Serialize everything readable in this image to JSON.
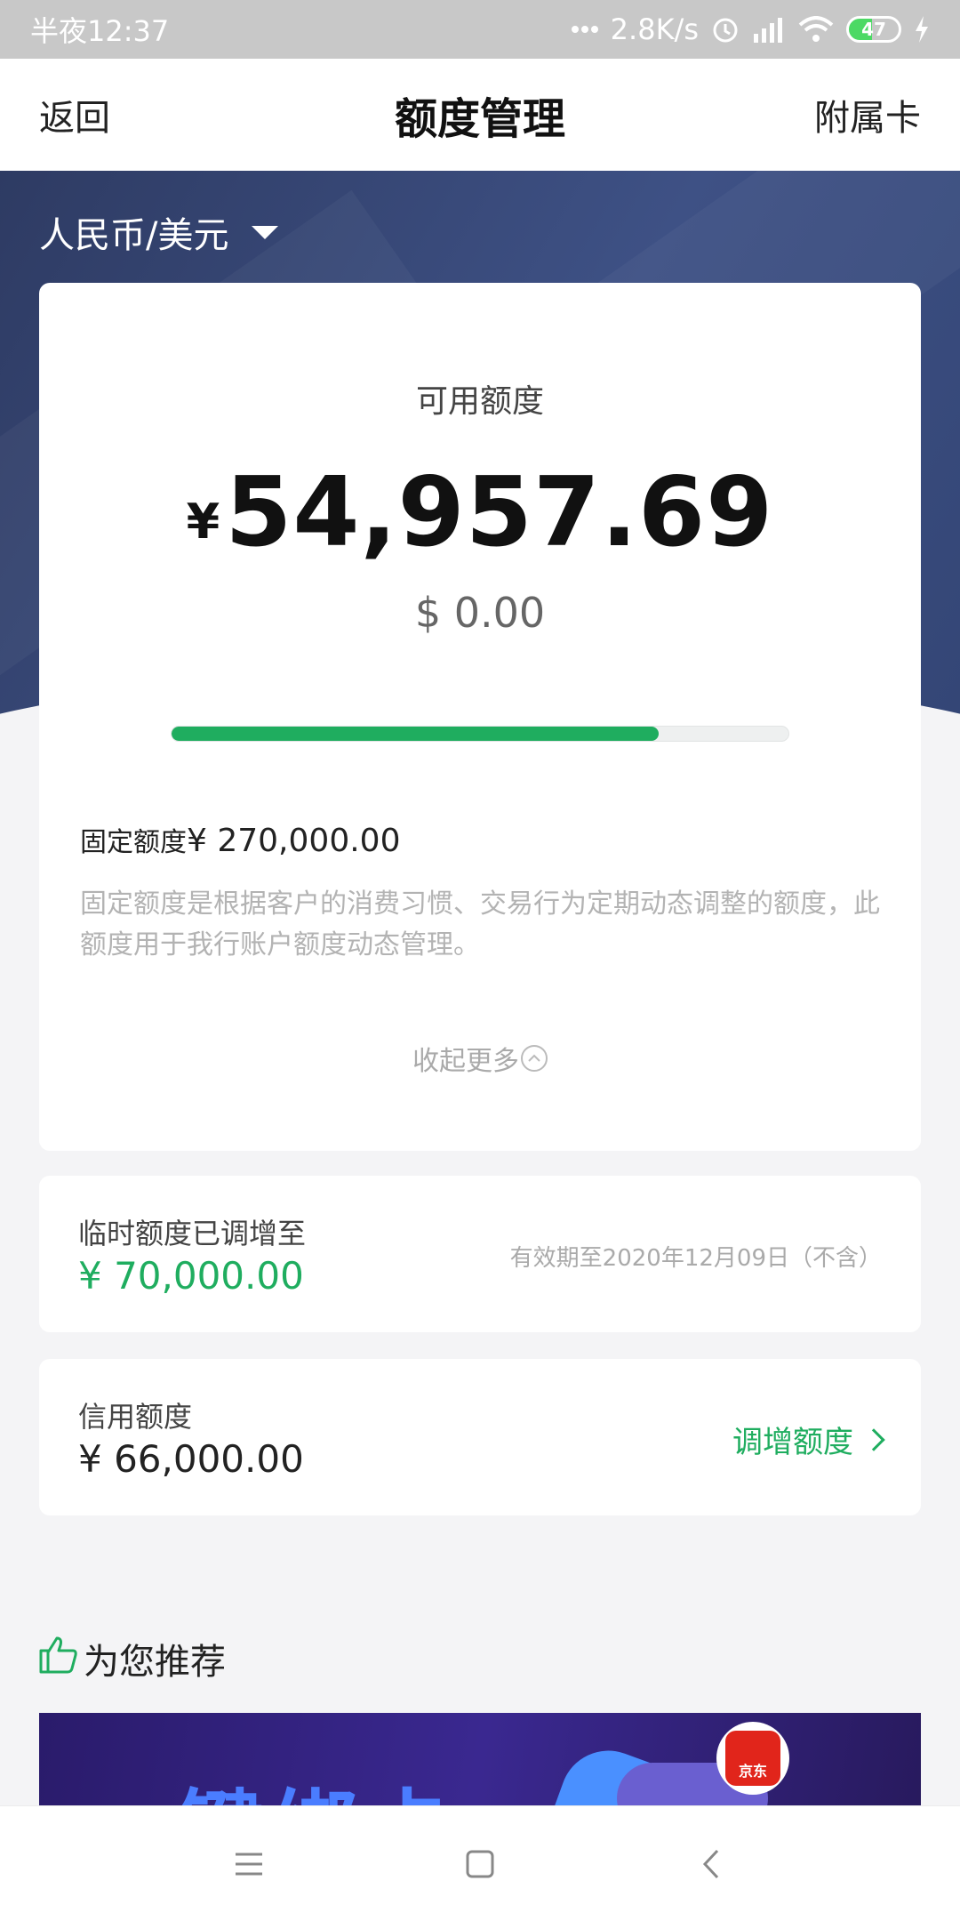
{
  "status_bar": {
    "time": "半夜12:37",
    "network_speed": "2.8K/s",
    "battery": "47",
    "icons": [
      "dots-icon",
      "alarm-icon",
      "signal-icon",
      "wifi-icon",
      "battery-icon",
      "charging-icon"
    ]
  },
  "nav": {
    "back_label": "返回",
    "title": "额度管理",
    "right_label": "附属卡"
  },
  "hero": {
    "currency_label": "人民币/美元"
  },
  "main_card": {
    "available_label": "可用额度",
    "available_currency": "¥",
    "available_amount": "54,957.69",
    "usd_amount": "$ 0.00",
    "usage_fraction": 0.79,
    "fixed_label": "固定额度",
    "fixed_amount": "¥ 270,000.00",
    "fixed_description": "固定额度是根据客户的消费习惯、交易行为定期动态调整的额度，此额度用于我行账户额度动态管理。",
    "collapse_label": "收起更多"
  },
  "temp_card": {
    "label": "临时额度已调增至",
    "amount": "¥ 70,000.00",
    "valid_text": "有效期至2020年12月09日（不含）"
  },
  "credit_card": {
    "label": "信用额度",
    "amount": "¥ 66,000.00",
    "increase_label": "调增额度"
  },
  "recommend": {
    "title": "为您推荐",
    "banner_text": "一键绑卡",
    "banner_badge": "京东"
  },
  "colors": {
    "accent_green": "#1fad5f",
    "hero_blue": "#3e5185",
    "background": "#f4f4f6"
  }
}
